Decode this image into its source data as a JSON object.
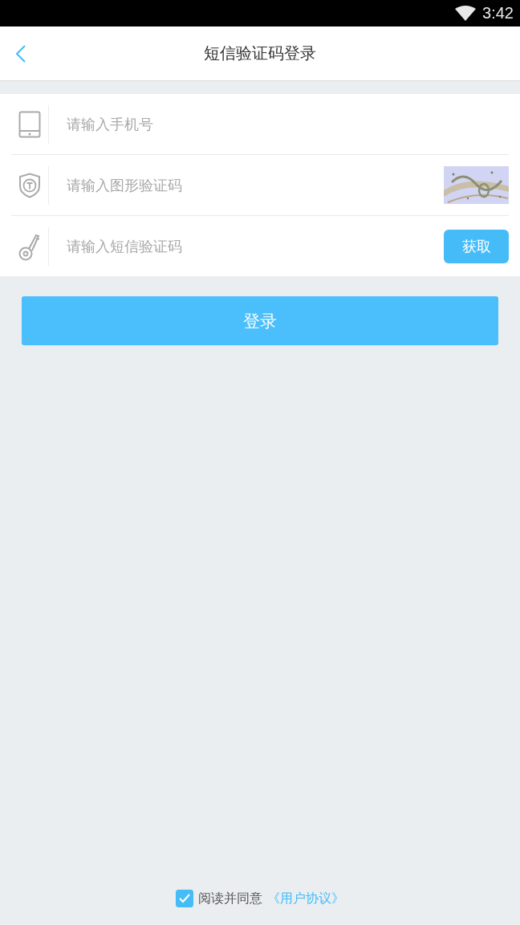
{
  "status_bar": {
    "time": "3:42"
  },
  "header": {
    "title": "短信验证码登录"
  },
  "fields": [
    {
      "kind": "phone",
      "placeholder": "请输入手机号"
    },
    {
      "kind": "captcha",
      "placeholder": "请输入图形验证码"
    },
    {
      "kind": "sms",
      "placeholder": "请输入短信验证码",
      "button": "获取"
    }
  ],
  "login_button": "登录",
  "agreement": {
    "checked": true,
    "text": "阅读并同意",
    "link": "《用户协议》"
  }
}
